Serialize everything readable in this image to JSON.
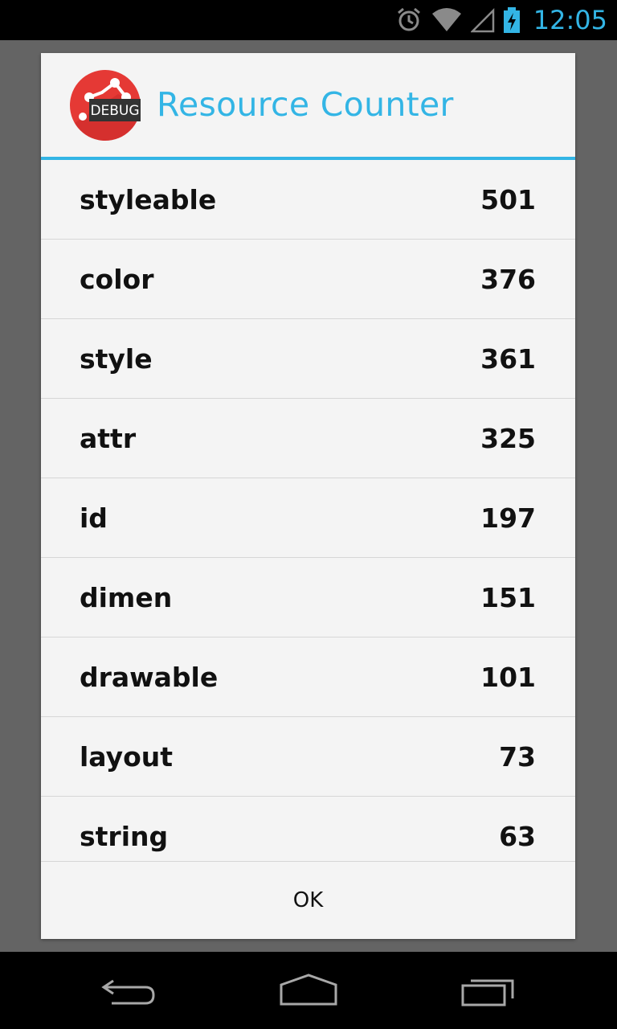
{
  "status_bar": {
    "time": "12:05",
    "icons": [
      "alarm-icon",
      "wifi-icon",
      "signal-icon",
      "battery-charging-icon"
    ],
    "accent_color": "#33b5e5"
  },
  "dialog": {
    "app_icon": {
      "name": "app-icon",
      "badge": "DEBUG"
    },
    "title": "Resource Counter",
    "items": [
      {
        "name": "styleable",
        "count": "501"
      },
      {
        "name": "color",
        "count": "376"
      },
      {
        "name": "style",
        "count": "361"
      },
      {
        "name": "attr",
        "count": "325"
      },
      {
        "name": "id",
        "count": "197"
      },
      {
        "name": "dimen",
        "count": "151"
      },
      {
        "name": "drawable",
        "count": "101"
      },
      {
        "name": "layout",
        "count": "73"
      },
      {
        "name": "string",
        "count": "63"
      }
    ],
    "ok_label": "OK"
  },
  "nav_bar": {
    "buttons": [
      "back-icon",
      "home-icon",
      "recents-icon"
    ]
  }
}
